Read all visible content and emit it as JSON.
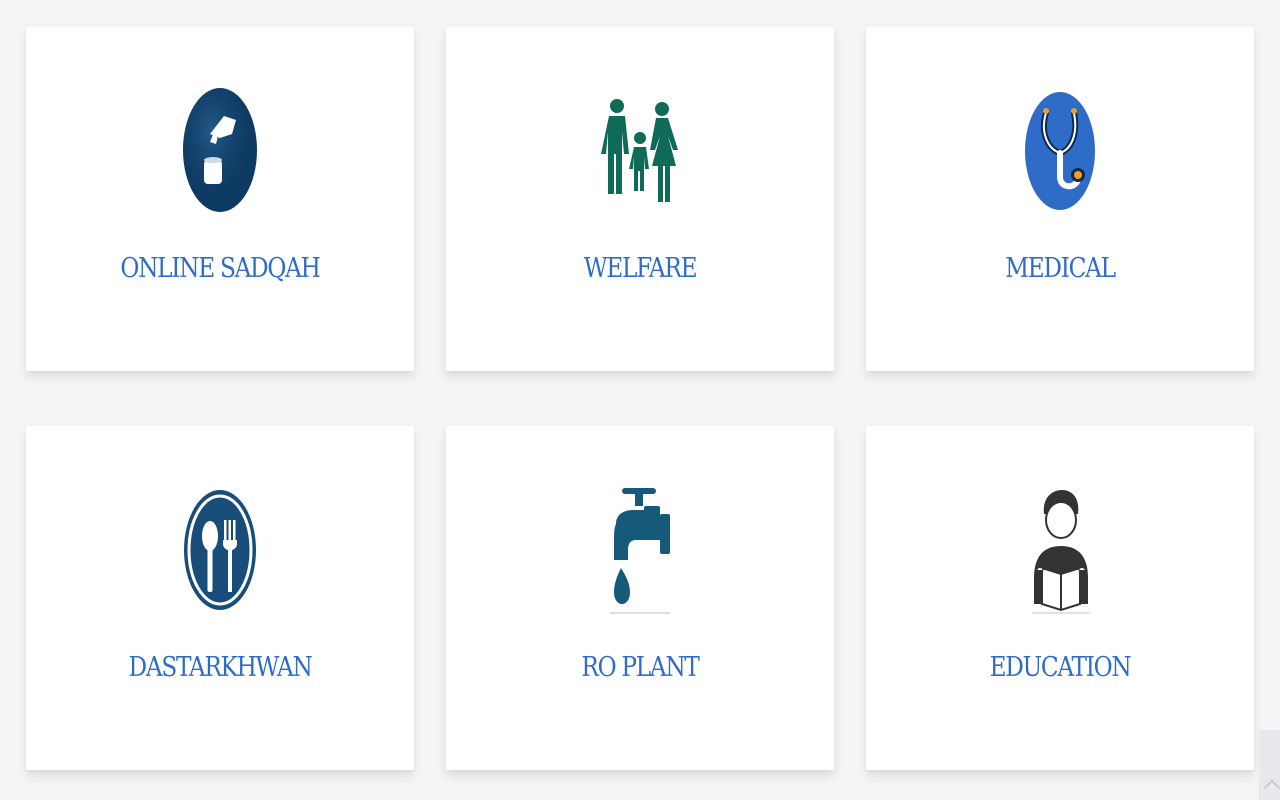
{
  "cards": [
    {
      "label": "ONLINE SADQAH",
      "icon": "donation-hand-icon",
      "color": "#0f3d6b"
    },
    {
      "label": "WELFARE",
      "icon": "family-icon",
      "color": "#0f6b57"
    },
    {
      "label": "MEDICAL",
      "icon": "stethoscope-icon",
      "color": "#2f6cc7"
    },
    {
      "label": "DASTARKHWAN",
      "icon": "spoon-fork-icon",
      "color": "#184d7a"
    },
    {
      "label": "RO PLANT",
      "icon": "water-tap-icon",
      "color": "#155a78"
    },
    {
      "label": "EDUCATION",
      "icon": "student-reading-icon",
      "color": "#333333"
    }
  ],
  "accent_color": "#2f6cc7",
  "scroll_top_icon": "chevron-up-icon"
}
